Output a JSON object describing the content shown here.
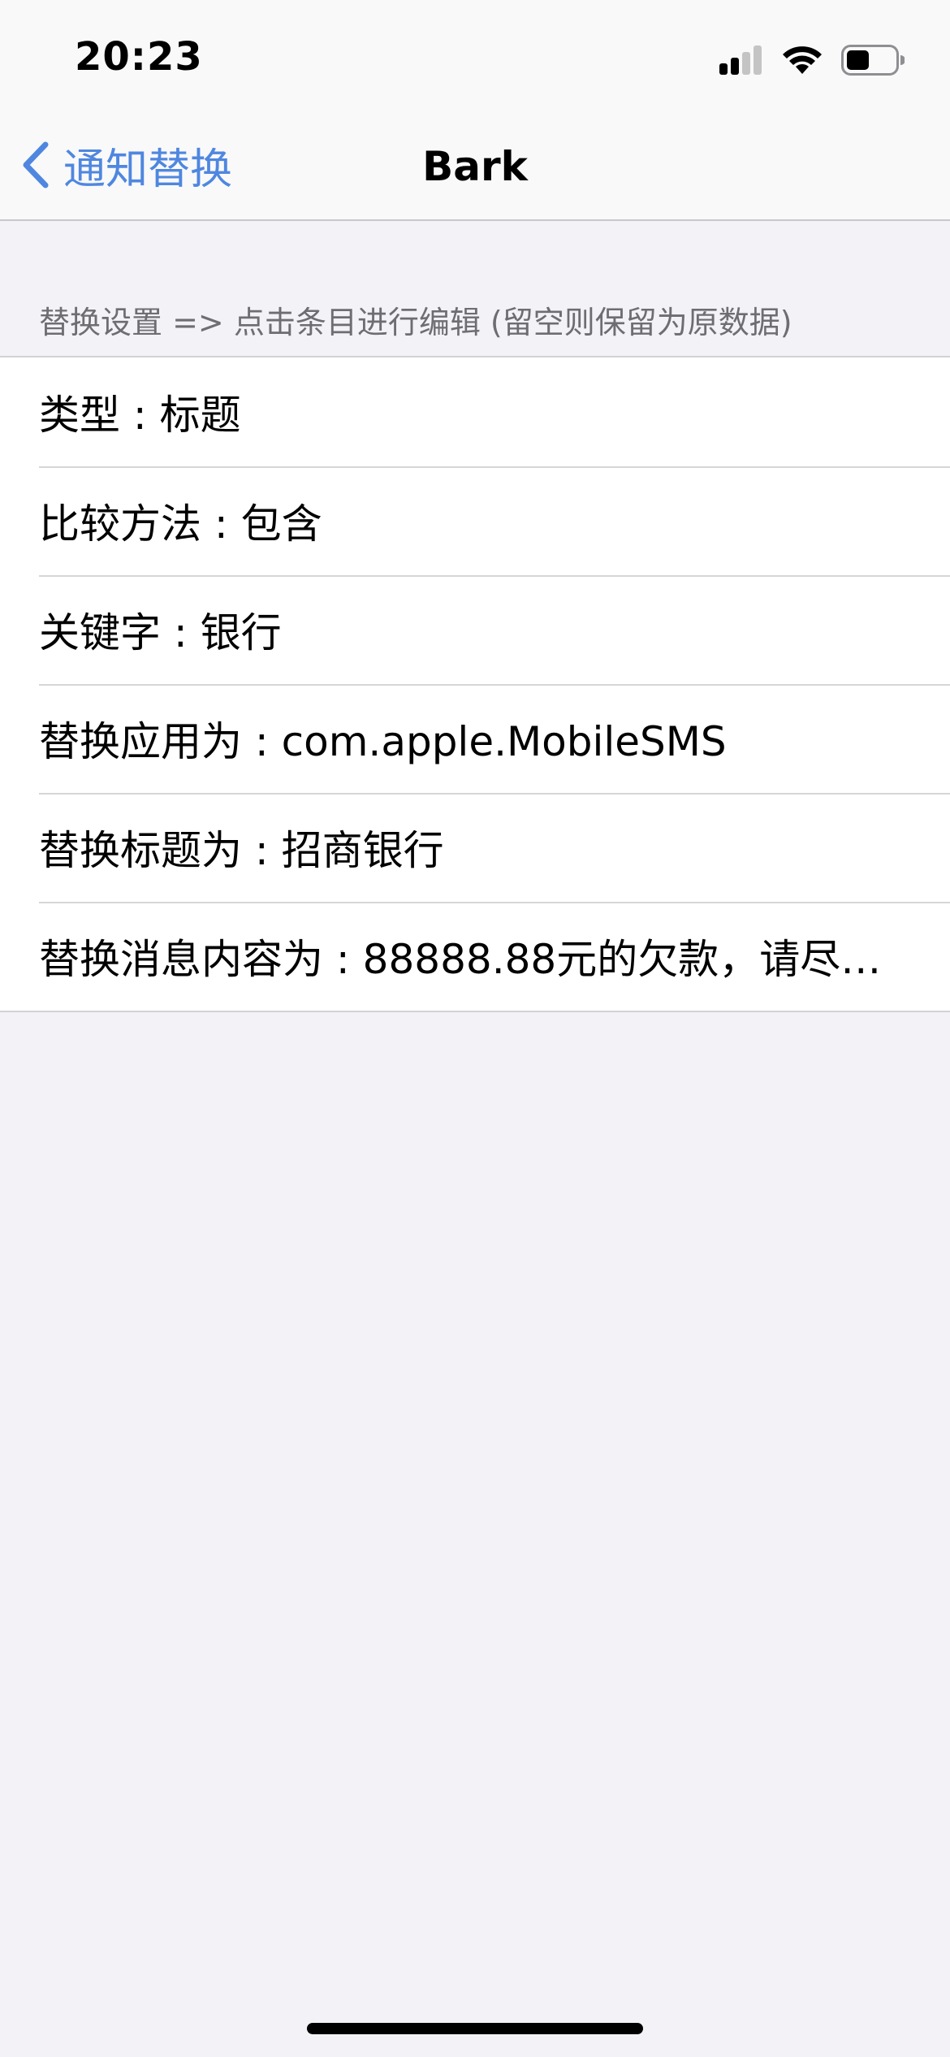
{
  "status_bar": {
    "time": "20:23"
  },
  "nav": {
    "back_label": "通知替换",
    "title": "Bark"
  },
  "section": {
    "header": "替换设置 => 点击条目进行编辑 (留空则保留为原数据)"
  },
  "rows": [
    {
      "text": "类型 : 标题"
    },
    {
      "text": "比较方法 : 包含"
    },
    {
      "text": "关键字 : 银行"
    },
    {
      "text": "替换应用为 : com.apple.MobileSMS"
    },
    {
      "text": "替换标题为 : 招商银行"
    },
    {
      "text": "替换消息内容为 : 88888.88元的欠款，请尽…"
    }
  ],
  "colors": {
    "accent": "#4f87e0",
    "background": "#f2f2f7",
    "section_text": "#6d6d72"
  }
}
